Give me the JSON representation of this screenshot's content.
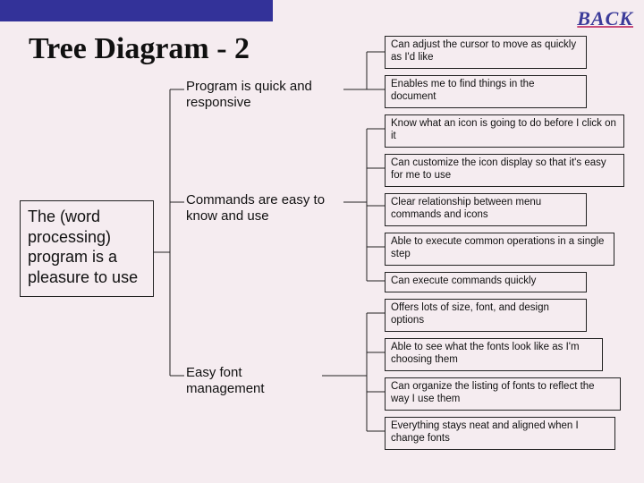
{
  "back_label": "BACK",
  "title": "Tree Diagram - 2",
  "root": "The (word processing) program is a pleasure to use",
  "mid": {
    "m1": "Program is quick and responsive",
    "m2": "Commands are easy to know and use",
    "m3": "Easy font management"
  },
  "leaves": {
    "l1": "Can adjust the cursor to move as quickly as I'd like",
    "l2": "Enables me to find things in the document",
    "l3": "Know what an icon is going to do before I click on it",
    "l4": "Can customize the icon display so that it's easy for me to use",
    "l5": "Clear relationship between menu commands and icons",
    "l6": "Able to execute common operations in a single step",
    "l7": "Can execute commands quickly",
    "l8": "Offers lots of size, font, and design options",
    "l9": "Able to see what the fonts look like as I'm choosing them",
    "l10": "Can organize the listing of fonts to reflect the way I use them",
    "l11": "Everything stays neat and aligned when I change fonts"
  }
}
